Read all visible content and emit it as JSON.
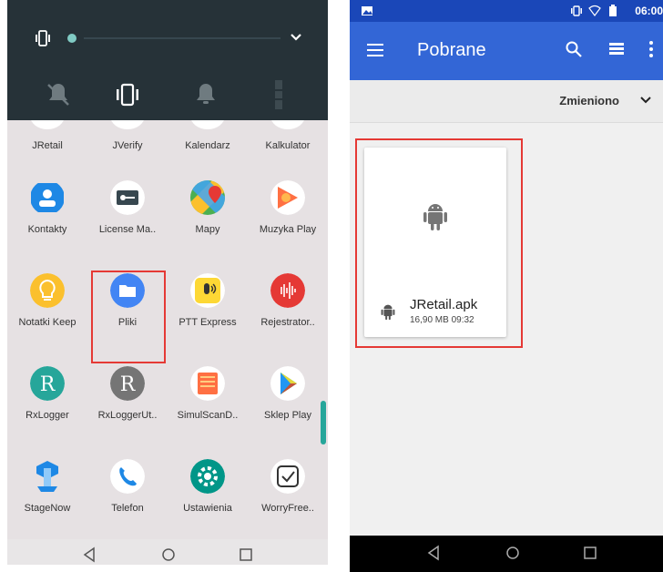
{
  "left_phone": {
    "quick_settings": {
      "icons": [
        "vibrate-icon",
        "dnd-off-icon",
        "vibrate-icon",
        "bell-icon",
        "more-vert-icon"
      ],
      "slider_color": "#80cbc4",
      "panel_color": "#263238"
    },
    "partial_row": [
      "JRetail",
      "JVerify",
      "Kalendarz",
      "Kalkulator"
    ],
    "apps": [
      {
        "label": "Kontakty",
        "icon": "contacts-icon"
      },
      {
        "label": "License Ma..",
        "icon": "key-icon"
      },
      {
        "label": "Mapy",
        "icon": "maps-icon"
      },
      {
        "label": "Muzyka Play",
        "icon": "music-icon"
      },
      {
        "label": "Notatki Keep",
        "icon": "bulb-icon"
      },
      {
        "label": "Pliki",
        "icon": "folder-icon"
      },
      {
        "label": "PTT Express",
        "icon": "ptt-icon"
      },
      {
        "label": "Rejestrator..",
        "icon": "recorder-icon"
      },
      {
        "label": "RxLogger",
        "icon": "rx-icon"
      },
      {
        "label": "RxLoggerUt..",
        "icon": "rx-util-icon"
      },
      {
        "label": "SimulScanD..",
        "icon": "scan-icon"
      },
      {
        "label": "Sklep Play",
        "icon": "play-store-icon"
      },
      {
        "label": "StageNow",
        "icon": "stagenow-icon"
      },
      {
        "label": "Telefon",
        "icon": "phone-icon"
      },
      {
        "label": "Ustawienia",
        "icon": "settings-icon"
      },
      {
        "label": "WorryFree..",
        "icon": "worryfree-icon"
      }
    ],
    "highlighted_app": "Pliki",
    "nav": [
      "back-icon",
      "home-icon",
      "recents-icon"
    ]
  },
  "right_phone": {
    "status_time": "06:00",
    "title": "Pobrane",
    "sort_label": "Zmieniono",
    "file": {
      "name": "JRetail.apk",
      "meta": "16,90 MB 09:32",
      "icon": "android-icon"
    },
    "colors": {
      "app_bar": "#3366d6",
      "status_bar": "#1a47b8",
      "highlight": "#e53935"
    },
    "nav": [
      "back-icon",
      "home-icon",
      "recents-icon"
    ]
  }
}
